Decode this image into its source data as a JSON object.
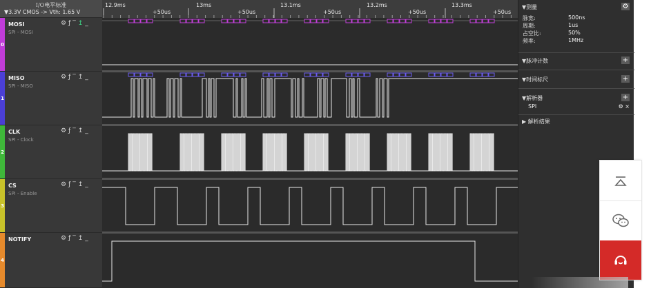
{
  "io_header": {
    "title": "I/O电平标准",
    "voltage": "▼3.3V CMOS -> Vth: 1.65 V"
  },
  "channels": [
    {
      "name": "MOSI",
      "sub": "SPI - MOSI",
      "num": "0",
      "color": "#c03cd8"
    },
    {
      "name": "MISO",
      "sub": "SPI - MISO",
      "num": "1",
      "color": "#4b3fd6"
    },
    {
      "name": "CLK",
      "sub": "SPI - Clock",
      "num": "2",
      "color": "#3fb83a"
    },
    {
      "name": "CS",
      "sub": "SPI - Enable",
      "num": "3",
      "color": "#c8c22a"
    },
    {
      "name": "NOTIFY",
      "sub": "",
      "num": "4",
      "color": "#e68a2c"
    }
  ],
  "channel_icons": {
    "gear": "⚙",
    "edge": "ƒ",
    "high": "‾",
    "rise": "↥",
    "low": "_"
  },
  "timeline": {
    "major_labels": [
      "12.9ms",
      "13ms",
      "13.1ms",
      "13.2ms",
      "13.3ms"
    ],
    "offset_label": "+50us"
  },
  "right_panel": {
    "measure": {
      "title": "▼测量",
      "rows": [
        {
          "key": "脉宽:",
          "value": "500ns"
        },
        {
          "key": "周期:",
          "value": "1us"
        },
        {
          "key": "占空比:",
          "value": "50%"
        },
        {
          "key": "频率:",
          "value": "1MHz"
        }
      ]
    },
    "pulse_count": {
      "title": "▼脉冲计数",
      "button": "+"
    },
    "time_marker": {
      "title": "▼时间标尺",
      "button": "+"
    },
    "analyzer": {
      "title": "▼解析器",
      "button": "+",
      "item": "SPI",
      "controls": "⚙ ×"
    },
    "results": {
      "title": "▶ 解析结果"
    }
  },
  "colors": {
    "panel_bg": "#2f2f2f",
    "plot_bg": "#2b2b2b",
    "service_red": "#d42a28"
  }
}
